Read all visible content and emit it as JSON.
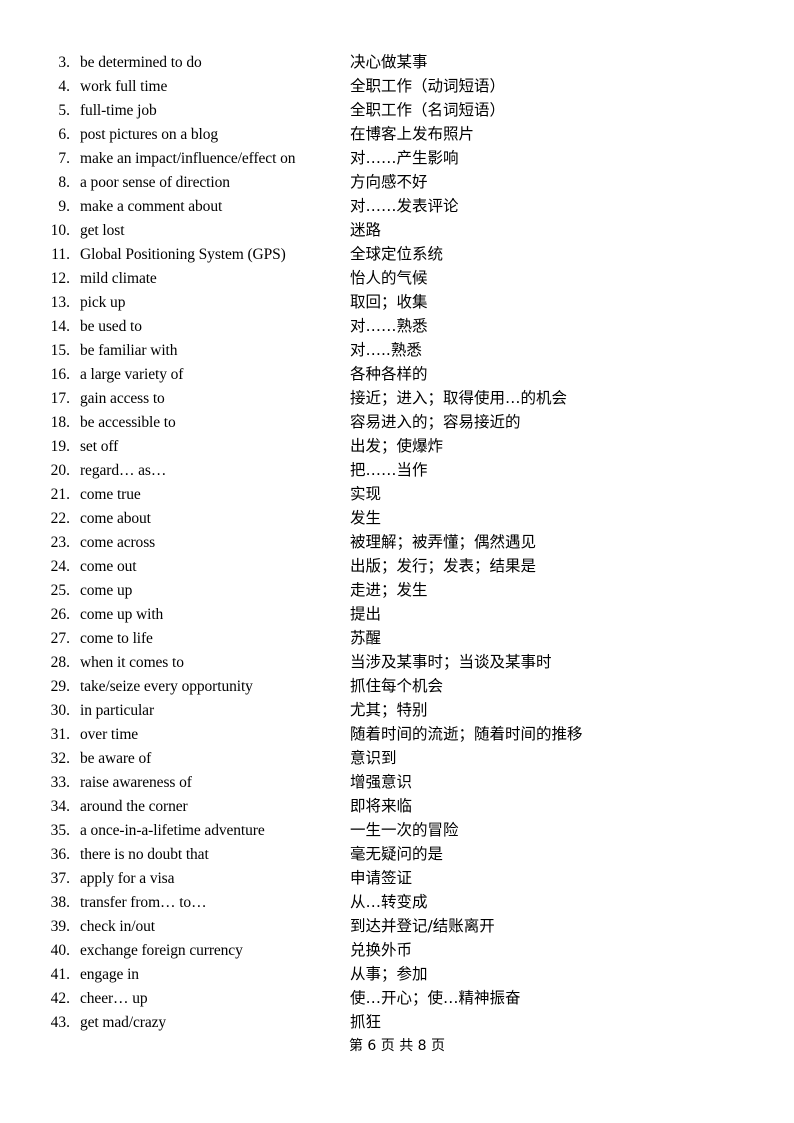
{
  "document": {
    "footer": "第 6 页 共 8 页",
    "page_number": 6,
    "total_pages": 8
  },
  "entries": [
    {
      "num": "3.",
      "en": "be determined to do",
      "zh": "决心做某事"
    },
    {
      "num": "4.",
      "en": "work full time",
      "zh": "全职工作（动词短语）"
    },
    {
      "num": "5.",
      "en": "full-time job",
      "zh": "全职工作（名词短语）"
    },
    {
      "num": "6.",
      "en": "post pictures on a blog",
      "zh": "在博客上发布照片"
    },
    {
      "num": "7.",
      "en": "make an impact/influence/effect on",
      "zh": "对……产生影响"
    },
    {
      "num": "8.",
      "en": "a poor sense of direction",
      "zh": "方向感不好"
    },
    {
      "num": "9.",
      "en": "make a comment about",
      "zh": "对……发表评论"
    },
    {
      "num": "10.",
      "en": "get lost",
      "zh": "迷路"
    },
    {
      "num": "11.",
      "en": "Global Positioning System (GPS)",
      "zh": "全球定位系统"
    },
    {
      "num": "12.",
      "en": "mild climate",
      "zh": "怡人的气候"
    },
    {
      "num": "13.",
      "en": "pick up",
      "zh": "取回；收集"
    },
    {
      "num": "14.",
      "en": "be used to",
      "zh": "对……熟悉"
    },
    {
      "num": "15.",
      "en": "be familiar with",
      "zh": "对…..熟悉"
    },
    {
      "num": "16.",
      "en": "a large variety of",
      "zh": "各种各样的"
    },
    {
      "num": "17.",
      "en": "gain access to",
      "zh": "接近；进入；取得使用…的机会"
    },
    {
      "num": "18.",
      "en": "be accessible to",
      "zh": "容易进入的；容易接近的"
    },
    {
      "num": "19.",
      "en": "set off",
      "zh": "出发；使爆炸"
    },
    {
      "num": "20.",
      "en": "regard… as…",
      "zh": "把……当作"
    },
    {
      "num": "21.",
      "en": "come true",
      "zh": "实现"
    },
    {
      "num": "22.",
      "en": "come about",
      "zh": "发生"
    },
    {
      "num": "23.",
      "en": "come across",
      "zh": "被理解；被弄懂；偶然遇见"
    },
    {
      "num": "24.",
      "en": "come out",
      "zh": "出版；发行；发表；结果是"
    },
    {
      "num": "25.",
      "en": "come up",
      "zh": "走进；发生"
    },
    {
      "num": "26.",
      "en": "come up with",
      "zh": "提出"
    },
    {
      "num": "27.",
      "en": "come to life",
      "zh": "苏醒"
    },
    {
      "num": "28.",
      "en": "when it comes to",
      "zh": "当涉及某事时；当谈及某事时"
    },
    {
      "num": "29.",
      "en": "take/seize every opportunity",
      "zh": "抓住每个机会"
    },
    {
      "num": "30.",
      "en": "in particular",
      "zh": "尤其；特别"
    },
    {
      "num": "31.",
      "en": "over time",
      "zh": "随着时间的流逝；随着时间的推移"
    },
    {
      "num": "32.",
      "en": "be aware of",
      "zh": "意识到"
    },
    {
      "num": "33.",
      "en": "raise awareness of",
      "zh": "增强意识"
    },
    {
      "num": "34.",
      "en": "around the corner",
      "zh": "即将来临"
    },
    {
      "num": "35.",
      "en": "a once-in-a-lifetime adventure",
      "zh": "一生一次的冒险"
    },
    {
      "num": "36.",
      "en": "there is no doubt that",
      "zh": "毫无疑问的是"
    },
    {
      "num": "37.",
      "en": "apply for a visa",
      "zh": "申请签证"
    },
    {
      "num": "38.",
      "en": "transfer from… to…",
      "zh": "从…转变成"
    },
    {
      "num": "39.",
      "en": "check in/out",
      "zh": "到达并登记/结账离开"
    },
    {
      "num": "40.",
      "en": "exchange foreign currency",
      "zh": "兑换外币"
    },
    {
      "num": "41.",
      "en": "engage in",
      "zh": "从事；参加"
    },
    {
      "num": "42.",
      "en": "cheer… up",
      "zh": "使…开心；使…精神振奋"
    },
    {
      "num": "43.",
      "en": "get mad/crazy",
      "zh": "抓狂"
    }
  ]
}
